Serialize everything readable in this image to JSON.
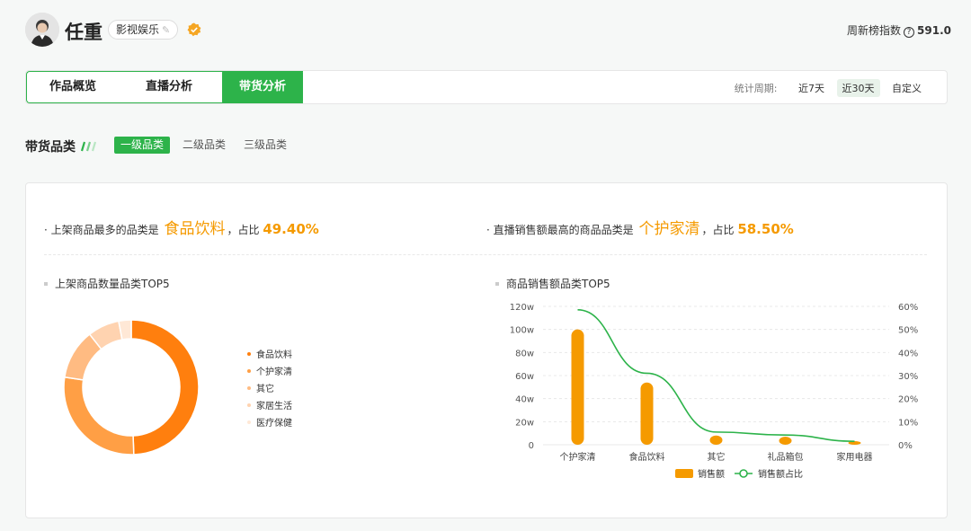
{
  "header": {
    "name": "任重",
    "tag": "影视娱乐",
    "index_label": "周新榜指数",
    "index_value": "591.0"
  },
  "tabs": [
    "作品概览",
    "直播分析",
    "带货分析"
  ],
  "active_tab": 2,
  "period": {
    "label": "统计周期:",
    "options": [
      "近7天",
      "近30天",
      "自定义"
    ],
    "active": 1
  },
  "category": {
    "title": "带货品类",
    "levels": [
      "一级品类",
      "二级品类",
      "三级品类"
    ],
    "active": 0
  },
  "summary": {
    "left_prefix": "· 上架商品最多的品类是",
    "left_highlight": "食品饮料",
    "left_suffix": "，占比",
    "left_pct": "49.40%",
    "right_prefix": "· 直播销售额最高的商品品类是",
    "right_highlight": "个护家清",
    "right_suffix": "，占比",
    "right_pct": "58.50%"
  },
  "colors": {
    "accent_green": "#2db34a",
    "highlight_orange": "#f59a00"
  },
  "chart_data": [
    {
      "type": "pie",
      "title": "上架商品数量品类TOP5",
      "categories": [
        "食品饮料",
        "个护家清",
        "其它",
        "家居生活",
        "医疗保健"
      ],
      "values": [
        49.4,
        28,
        12,
        7.6,
        3
      ],
      "colors": [
        "#ff7f0e",
        "#ff9f45",
        "#ffbb82",
        "#ffd3b0",
        "#ffe8d6"
      ],
      "legend": "right"
    },
    {
      "type": "bar",
      "title": "商品销售额品类TOP5",
      "categories": [
        "个护家清",
        "食品饮料",
        "其它",
        "礼品箱包",
        "家用电器"
      ],
      "series": [
        {
          "name": "销售额",
          "type": "bar",
          "values": [
            100,
            54,
            8,
            7,
            3
          ],
          "color": "#f59a00"
        },
        {
          "name": "销售额占比",
          "type": "line",
          "values": [
            58.5,
            31,
            5.5,
            4.2,
            1.5
          ],
          "color": "#2db34a"
        }
      ],
      "y_left": {
        "ticks": [
          "0",
          "20w",
          "40w",
          "60w",
          "80w",
          "100w",
          "120w"
        ],
        "range": [
          0,
          120
        ]
      },
      "y_right": {
        "ticks": [
          "0%",
          "10%",
          "20%",
          "30%",
          "40%",
          "50%",
          "60%"
        ],
        "range": [
          0,
          60
        ]
      },
      "grid": true,
      "legend": "bottom"
    }
  ]
}
